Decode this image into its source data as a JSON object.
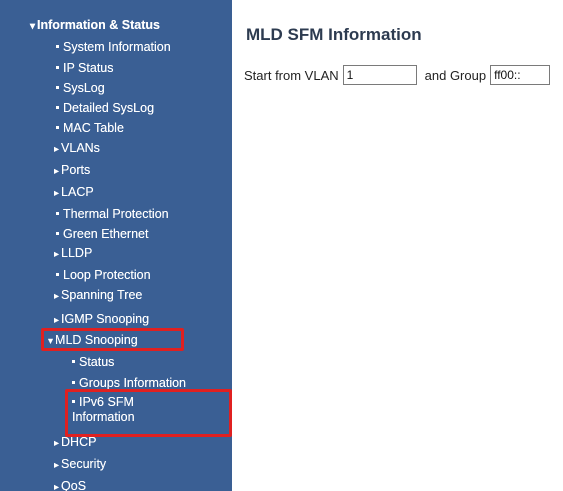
{
  "sidebar": {
    "items": [
      {
        "label": "Information & Status",
        "marker": "▾",
        "bold": true
      },
      {
        "label": "System Information",
        "marker": "bullet"
      },
      {
        "label": "IP Status",
        "marker": "bullet"
      },
      {
        "label": "SysLog",
        "marker": "bullet"
      },
      {
        "label": "Detailed SysLog",
        "marker": "bullet"
      },
      {
        "label": "MAC Table",
        "marker": "bullet"
      },
      {
        "label": "VLANs",
        "marker": "▸"
      },
      {
        "label": "Ports",
        "marker": "▸"
      },
      {
        "label": "LACP",
        "marker": "▸"
      },
      {
        "label": "Thermal Protection",
        "marker": "bullet"
      },
      {
        "label": "Green Ethernet",
        "marker": "bullet"
      },
      {
        "label": "LLDP",
        "marker": "▸"
      },
      {
        "label": "Loop Protection",
        "marker": "bullet"
      },
      {
        "label": "Spanning Tree",
        "marker": "▸"
      },
      {
        "label": "IGMP Snooping",
        "marker": "▸"
      },
      {
        "label": "MLD Snooping",
        "marker": "▾"
      },
      {
        "label": "Status",
        "marker": "bullet"
      },
      {
        "label": "Groups Information",
        "marker": "bullet"
      },
      {
        "label": "IPv6 SFM Information",
        "marker": "bullet"
      },
      {
        "label": "DHCP",
        "marker": "▸"
      },
      {
        "label": "Security",
        "marker": "▸"
      },
      {
        "label": "QoS",
        "marker": "▸"
      }
    ]
  },
  "main": {
    "title": "MLD SFM Information",
    "start_label": "Start from VLAN",
    "vlan_value": "1",
    "group_label": "and Group",
    "group_value": "ff00::"
  },
  "colors": {
    "sidebar_bg": "#3a5f94",
    "highlight": "#e02020",
    "title": "#2d3b50"
  }
}
